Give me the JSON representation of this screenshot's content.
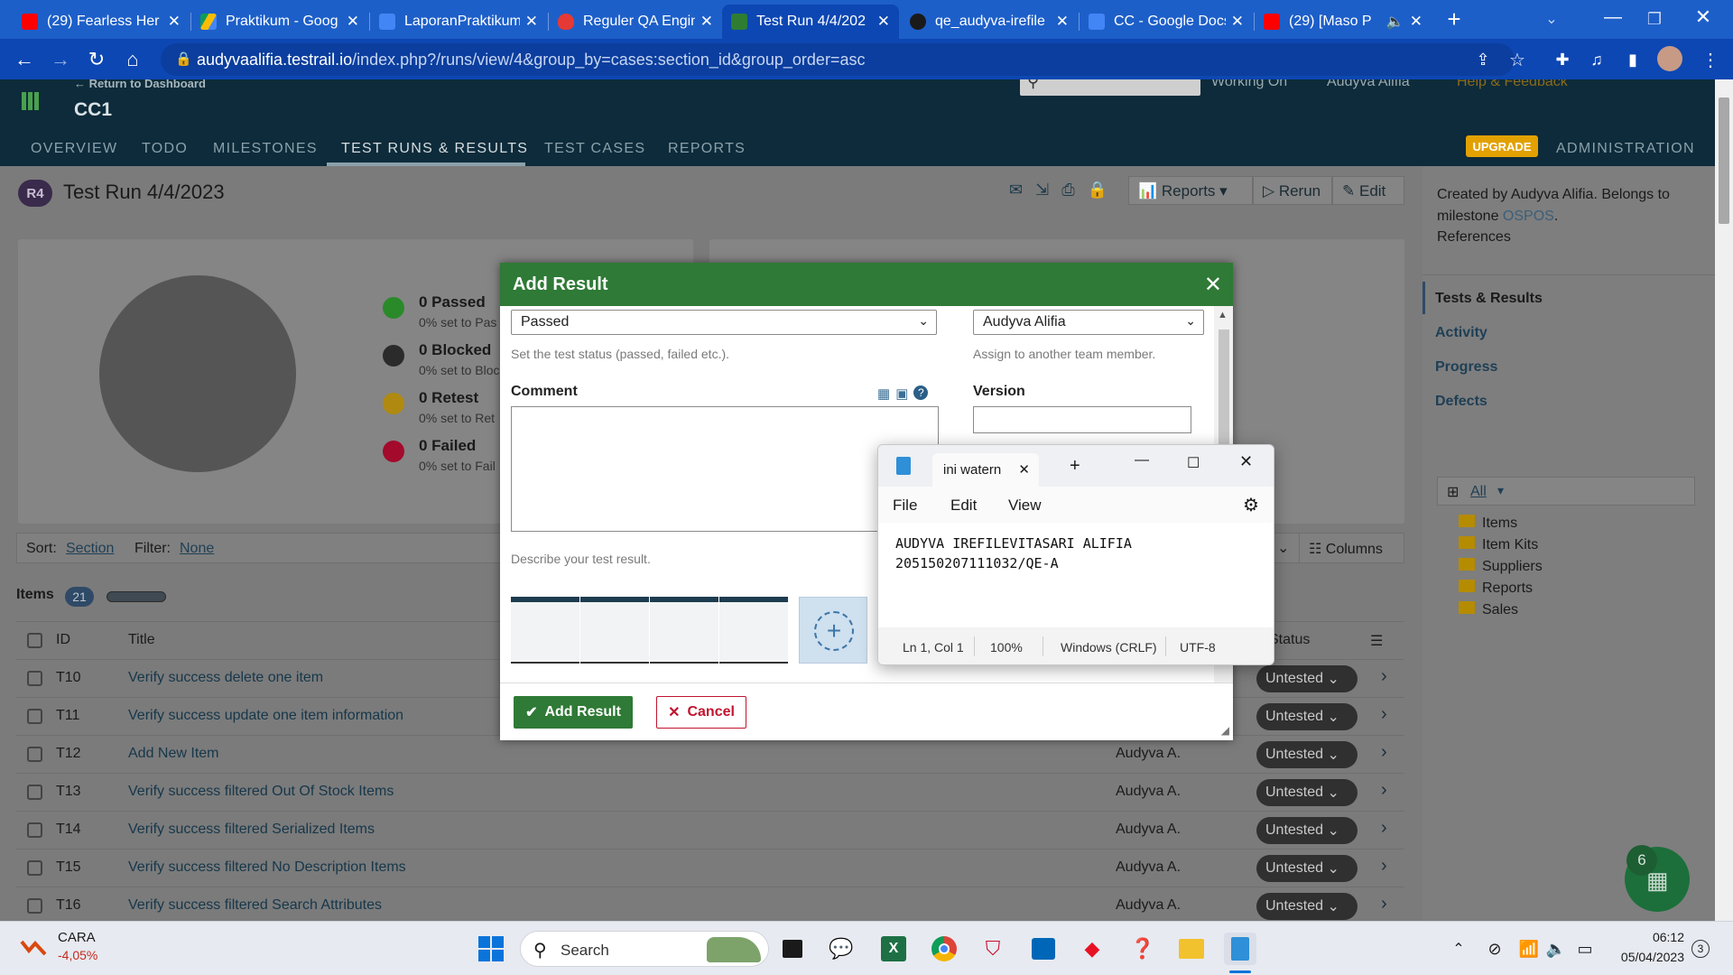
{
  "browser": {
    "tabs": [
      {
        "label": "(29) Fearless Her",
        "icon": "youtube-icon",
        "color": "#ff0000"
      },
      {
        "label": "Praktikum - Goog",
        "icon": "google-drive-icon",
        "color": "#fbbc04"
      },
      {
        "label": "LaporanPraktikum",
        "icon": "google-docs-icon",
        "color": "#4285f4"
      },
      {
        "label": "Reguler QA Engin",
        "icon": "red-drop-icon",
        "color": "#e53935"
      },
      {
        "label": "Test Run 4/4/202",
        "icon": "testrail-icon",
        "color": "#2e7d32"
      },
      {
        "label": "qe_audyva-irefile",
        "icon": "github-icon",
        "color": "#222"
      },
      {
        "label": "CC - Google Docs",
        "icon": "google-docs-icon",
        "color": "#4285f4"
      },
      {
        "label": "(29) [Maso P",
        "icon": "youtube-icon",
        "color": "#ff0000"
      }
    ],
    "url_host": "audyvaalifia.testrail.io",
    "url_path": "/index.php?/runs/view/4&group_by=cases:section_id&group_order=asc"
  },
  "testrail": {
    "back_link": "← Return to Dashboard",
    "project": "CC1",
    "top_links": [
      "Working On",
      "Audyva Alifia",
      "Help & Feedback"
    ],
    "nav": [
      "OVERVIEW",
      "TODO",
      "MILESTONES",
      "TEST RUNS & RESULTS",
      "TEST CASES",
      "REPORTS"
    ],
    "upgrade": "UPGRADE",
    "administration": "ADMINISTRATION",
    "run_badge": "R4",
    "run_title": "Test Run 4/4/2023",
    "toolbar": {
      "reports": "Reports",
      "rerun": "Rerun",
      "edit": "Edit"
    },
    "stats": [
      {
        "label": "0 Passed",
        "sub": "0% set to Pas",
        "color": "#2a8a2a"
      },
      {
        "label": "0 Blocked",
        "sub": "0% set to Bloc",
        "color": "#2b2b2b"
      },
      {
        "label": "0 Retest",
        "sub": "0% set to Ret",
        "color": "#b08a10"
      },
      {
        "label": "0 Failed",
        "sub": "0% set to Fail",
        "color": "#a30a2c"
      }
    ],
    "sort_label": "Sort:",
    "sort_value": "Section",
    "filter_label": "Filter:",
    "filter_value": "None",
    "columns_btn": "Columns",
    "section_title": "Items",
    "section_count": "21",
    "col_id": "ID",
    "col_title": "Title",
    "col_status": "Status",
    "rows": [
      {
        "id": "T10",
        "title": "Verify success delete one item",
        "assignee": "",
        "status": "Untested"
      },
      {
        "id": "T11",
        "title": "Verify success update one item information",
        "assignee": "",
        "status": "Untested"
      },
      {
        "id": "T12",
        "title": "Add New Item",
        "assignee": "Audyva A.",
        "status": "Untested"
      },
      {
        "id": "T13",
        "title": "Verify success filtered Out Of Stock Items",
        "assignee": "Audyva A.",
        "status": "Untested"
      },
      {
        "id": "T14",
        "title": "Verify success filtered Serialized Items",
        "assignee": "Audyva A.",
        "status": "Untested"
      },
      {
        "id": "T15",
        "title": "Verify success filtered No Description Items",
        "assignee": "Audyva A.",
        "status": "Untested"
      },
      {
        "id": "T16",
        "title": "Verify success filtered Search Attributes",
        "assignee": "Audyva A.",
        "status": "Untested"
      }
    ],
    "sidebar": {
      "created_prefix": "Created by Audyva Alifia. Belongs to milestone ",
      "milestone": "OSPOS",
      "created_suffix": ".",
      "references": "References",
      "links": [
        "Tests & Results",
        "Activity",
        "Progress",
        "Defects"
      ],
      "tree_all": "All",
      "tree": [
        "Items",
        "Item Kits",
        "Suppliers",
        "Reports",
        "Sales"
      ]
    }
  },
  "dialog": {
    "title": "Add Result",
    "status_value": "Passed",
    "status_hint": "Set the test status (passed, failed etc.).",
    "assign_value": "Audyva Alifia",
    "assign_hint": "Assign to another team member.",
    "comment_label": "Comment",
    "version_label": "Version",
    "describe_hint": "Describe your test result.",
    "add_btn": "Add Result",
    "cancel_btn": "Cancel"
  },
  "notepad": {
    "tab_title": "ini watern",
    "menu": [
      "File",
      "Edit",
      "View"
    ],
    "line1": "AUDYVA IREFILEVITASARI ALIFIA",
    "line2": "205150207111032/QE-A",
    "status": [
      "Ln 1, Col 1",
      "100%",
      "Windows (CRLF)",
      "UTF-8"
    ]
  },
  "taskbar": {
    "stock_name": "CARA",
    "stock_change": "-4,05%",
    "search": "Search",
    "time": "06:12",
    "date": "05/04/2023",
    "notif_count": "3",
    "fab_count": "6"
  }
}
